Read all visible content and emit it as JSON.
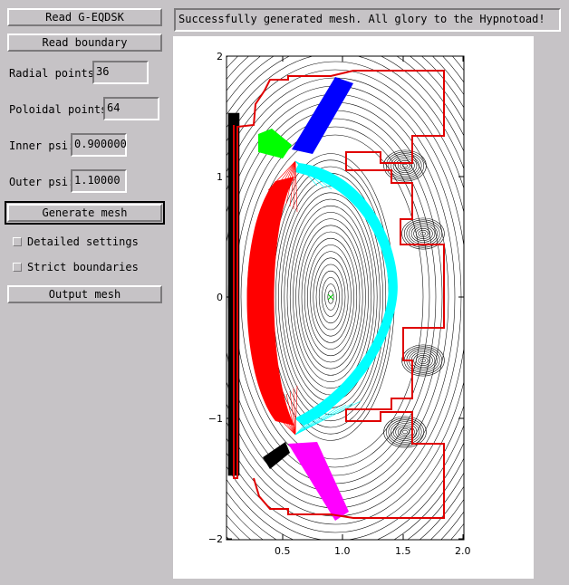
{
  "buttons": {
    "read_geqdsk": "Read G-EQDSK",
    "read_boundary": "Read boundary",
    "generate_mesh": "Generate mesh",
    "output_mesh": "Output mesh"
  },
  "fields": {
    "radial_label": "Radial points:",
    "radial_value": "36",
    "poloidal_label": "Poloidal points:",
    "poloidal_value": "64",
    "inner_psi_label": "Inner psi:",
    "inner_psi_value": "0.900000",
    "outer_psi_label": "Outer psi:",
    "outer_psi_value": "1.10000"
  },
  "checkboxes": {
    "detailed_settings": "Detailed settings",
    "strict_boundaries": "Strict boundaries"
  },
  "status": "Successfully generated mesh. All glory to the Hypnotoad!",
  "plot": {
    "x_ticks": [
      "0.5",
      "1.0",
      "1.5",
      "2.0"
    ],
    "y_ticks": [
      "2",
      "1",
      "0",
      "−1",
      "−2"
    ],
    "colors": {
      "boundary": "#e00000",
      "contours": "#000000",
      "core_inner": "#ff0000",
      "core_outer": "#00ffff",
      "upper_leg_outer": "#0000ff",
      "upper_leg_inner": "#00ff00",
      "lower_leg_outer": "#ff00ff",
      "lower_leg_inner": "#000000",
      "axis_marker": "#00c000"
    }
  }
}
